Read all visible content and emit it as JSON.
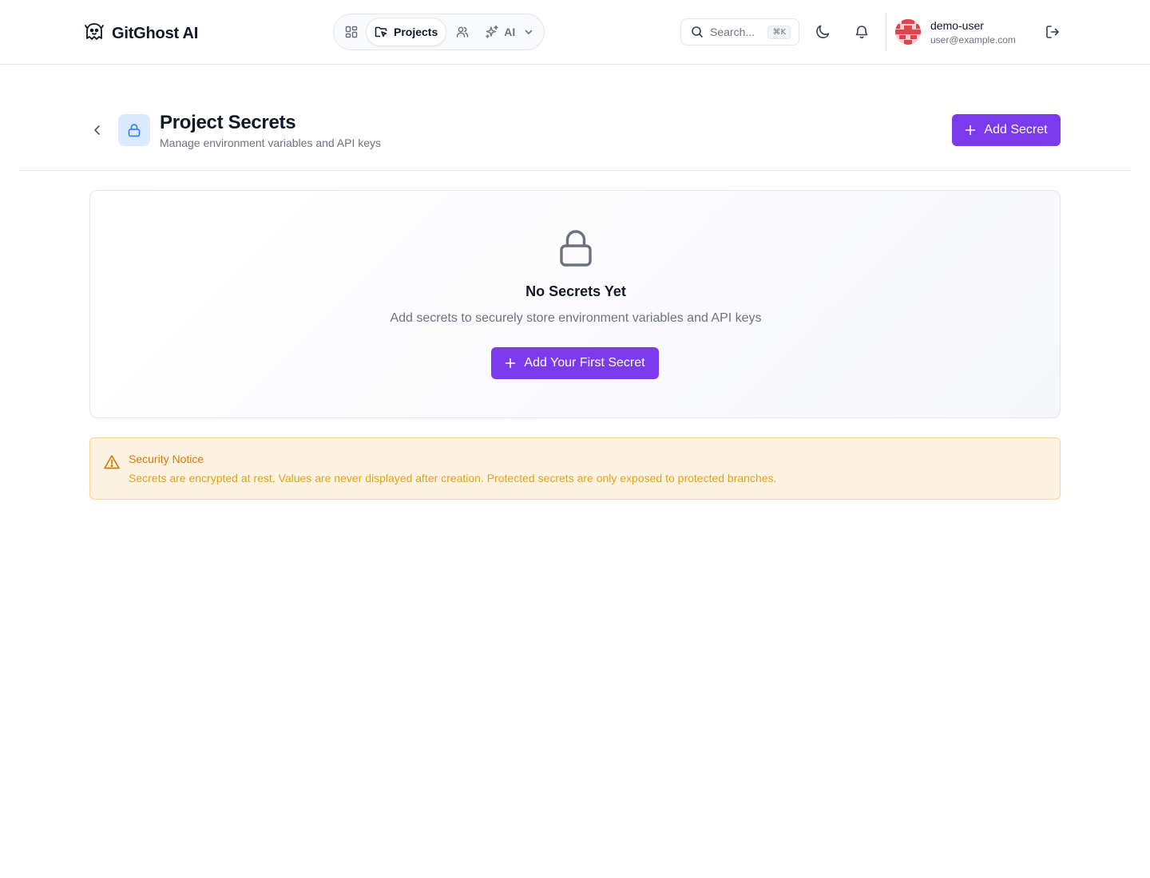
{
  "header": {
    "brand": "GitGhost AI",
    "nav": {
      "dashboard_icon": "dashboard-grid-icon",
      "active_label": "Projects",
      "users_icon": "users-icon",
      "ai_label": "AI"
    },
    "search": {
      "placeholder": "Search...",
      "shortcut": "⌘K"
    },
    "user": {
      "name": "demo-user",
      "email": "user@example.com"
    }
  },
  "page": {
    "title": "Project Secrets",
    "subtitle": "Manage environment variables and API keys",
    "add_button": "Add Secret"
  },
  "empty_state": {
    "title": "No Secrets Yet",
    "description": "Add secrets to securely store environment variables and API keys",
    "button": "Add Your First Secret"
  },
  "notice": {
    "title": "Security Notice",
    "text": "Secrets are encrypted at rest. Values are never displayed after creation. Protected secrets are only exposed to protected branches."
  },
  "colors": {
    "accent": "#7c3aed",
    "notice_bg": "#fef3e2",
    "notice_text": "#d97706",
    "icon_blue": "#3b82f6"
  }
}
